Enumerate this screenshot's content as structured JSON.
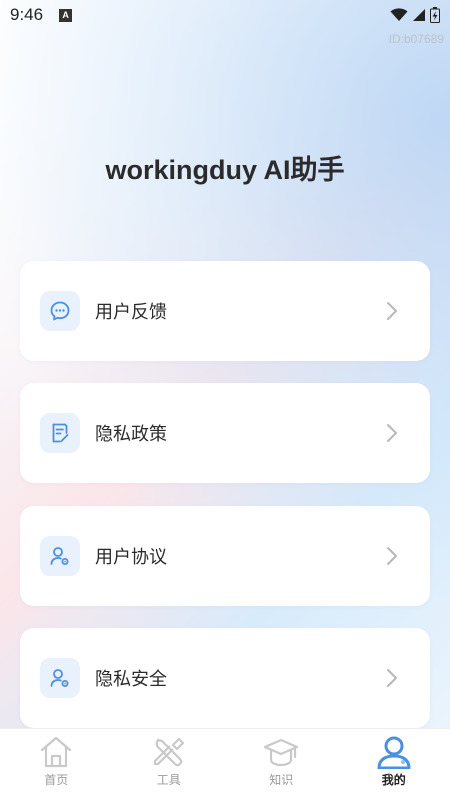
{
  "status_bar": {
    "time": "9:46",
    "notification_letter": "A"
  },
  "id_text": "ID:b07689",
  "app_title": "workingduy AI助手",
  "menu_items": [
    {
      "label": "用户反馈",
      "icon": "chat-bubble-icon"
    },
    {
      "label": "隐私政策",
      "icon": "document-icon"
    },
    {
      "label": "用户协议",
      "icon": "user-settings-icon"
    },
    {
      "label": "隐私安全",
      "icon": "user-settings-icon"
    }
  ],
  "bottom_nav": [
    {
      "label": "首页",
      "icon": "home-icon"
    },
    {
      "label": "工具",
      "icon": "tools-icon"
    },
    {
      "label": "知识",
      "icon": "graduation-cap-icon"
    },
    {
      "label": "我的",
      "icon": "person-icon",
      "active": true
    }
  ],
  "colors": {
    "accent": "#4a90e2",
    "icon_bg": "#e9f1fd",
    "chevron": "#b8b8b8",
    "nav_inactive": "#c9c9c9"
  }
}
